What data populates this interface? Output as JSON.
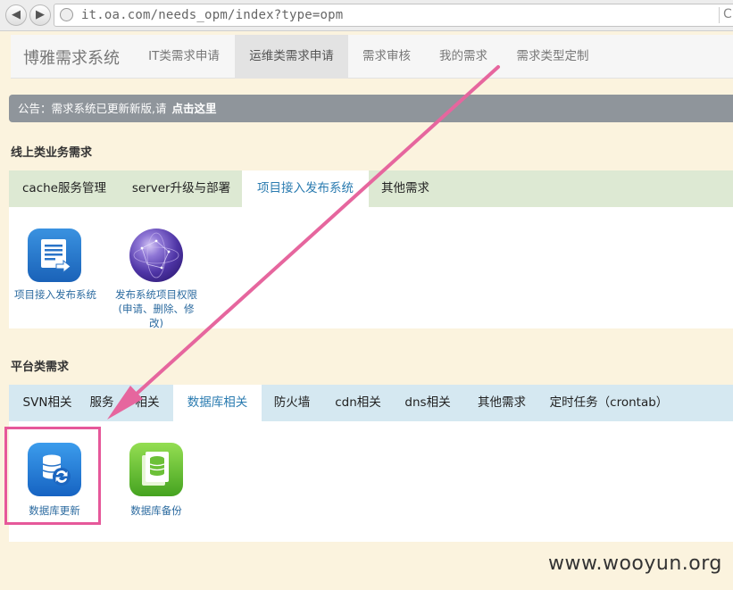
{
  "browser": {
    "url": "it.oa.com/needs_opm/index?type=opm"
  },
  "nav": {
    "brand": "博雅需求系统",
    "items": [
      "IT类需求申请",
      "运维类需求申请",
      "需求审核",
      "我的需求",
      "需求类型定制"
    ],
    "active_index": 1
  },
  "notice": {
    "text": "公告：需求系统已更新新版,请",
    "link": "点击这里"
  },
  "section1": {
    "title": "线上类业务需求",
    "tabs": [
      "cache服务管理",
      "server升级与部署",
      "项目接入发布系统",
      "其他需求"
    ],
    "active_index": 2,
    "apps": [
      {
        "label": "项目接入发布系统",
        "icon": "document-arrow-icon"
      },
      {
        "label_lines": [
          "发布系统项目权限",
          "(申请、删除、修",
          "改)"
        ],
        "icon": "purple-sphere-icon"
      }
    ]
  },
  "section2": {
    "title": "平台类需求",
    "tabs": [
      "SVN相关",
      "服务",
      "相关",
      "数据库相关",
      "防火墙",
      "cdn相关",
      "dns相关",
      "其他需求",
      "定时任务（crontab）"
    ],
    "active_index": 3,
    "apps": [
      {
        "label": "数据库更新",
        "icon": "database-refresh-icon"
      },
      {
        "label": "数据库备份",
        "icon": "database-backup-icon"
      }
    ]
  },
  "annotation": {
    "arrow_color": "#e6669e",
    "box_color": "#e6589a"
  },
  "watermark": "www.wooyun.org"
}
